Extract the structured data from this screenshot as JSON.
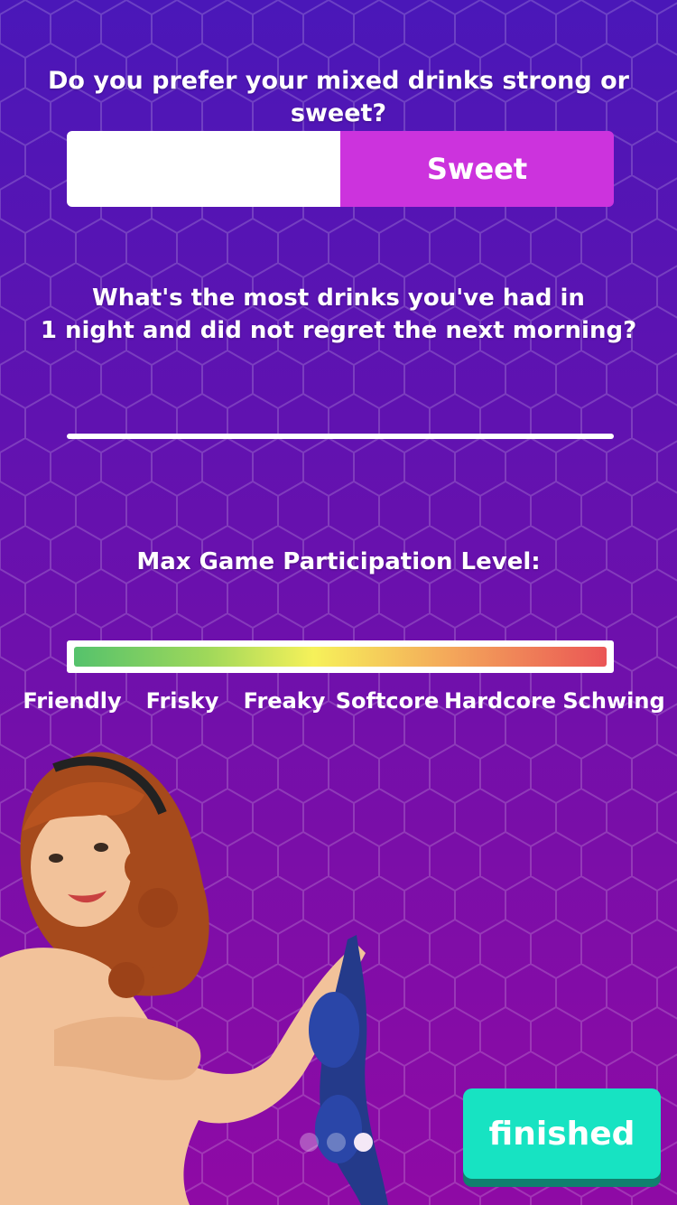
{
  "questions": {
    "drinks_preference": "Do you prefer your mixed drinks strong or sweet?",
    "most_drinks_line1": "What's the most drinks you've had in",
    "most_drinks_line2": "1 night and did not regret the next morning?",
    "participation": "Max Game Participation Level:"
  },
  "toggle": {
    "left_label": "",
    "right_label": "Sweet",
    "selected": "Sweet"
  },
  "answer_field": {
    "value": ""
  },
  "participation_level": {
    "levels": [
      "Friendly",
      "Frisky",
      "Freaky",
      "Softcore",
      "Hardcore",
      "Schwing"
    ],
    "selected_fraction": 1.0
  },
  "pagination": {
    "total": 3,
    "active_index": 2
  },
  "finish_button": {
    "label": "finished"
  },
  "colors": {
    "toggle_selected": "#cc33dd",
    "finish_button": "#17e3c2",
    "background_top": "#4a17b8",
    "background_bottom": "#8f0aa5"
  }
}
